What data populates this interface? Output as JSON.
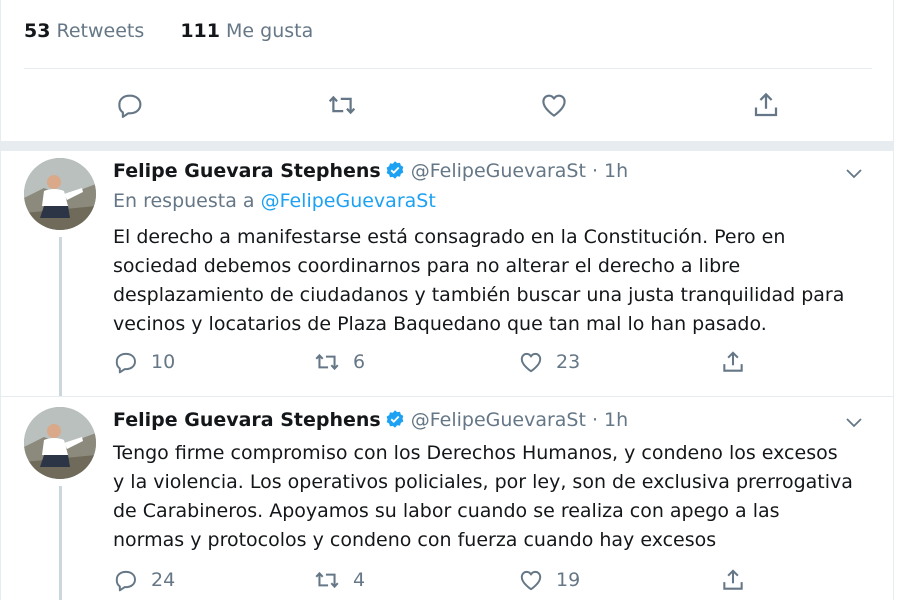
{
  "stats": {
    "retweets_count": "53",
    "retweets_label": "Retweets",
    "likes_count": "111",
    "likes_label": "Me gusta"
  },
  "main_actions": [
    "reply-icon",
    "retweet-icon",
    "like-icon",
    "share-icon"
  ],
  "tweets": [
    {
      "name": "Felipe Guevara Stephens",
      "handle": "@FelipeGuevaraSt · 1h",
      "reply_prefix": "En respuesta a",
      "reply_handle": "@FelipeGuevaraSt",
      "lines": [
        "El derecho a manifestarse está consagrado en la Constitución. Pero en",
        "sociedad debemos coordinarnos para no alterar el derecho a libre",
        "desplazamiento de ciudadanos y también buscar una justa tranquilidad para",
        "vecinos y locatarios de Plaza Baquedano que tan mal lo han pasado."
      ],
      "replies": "10",
      "retweets": "6",
      "likes": "23"
    },
    {
      "name": "Felipe Guevara Stephens",
      "handle": "@FelipeGuevaraSt · 1h",
      "lines": [
        "Tengo firme compromiso con los Derechos Humanos, y condeno los excesos",
        "y la violencia. Los operativos policiales, por ley, son de exclusiva prerrogativa",
        "de Carabineros. Apoyamos su labor cuando se realiza con apego a las",
        "normas y protocolos y condeno con fuerza cuando hay excesos"
      ],
      "replies": "24",
      "retweets": "4",
      "likes": "19"
    }
  ],
  "colors": {
    "text": "#14171a",
    "muted": "#657786",
    "link": "#1da1f2",
    "divider": "#e6ecf0"
  }
}
